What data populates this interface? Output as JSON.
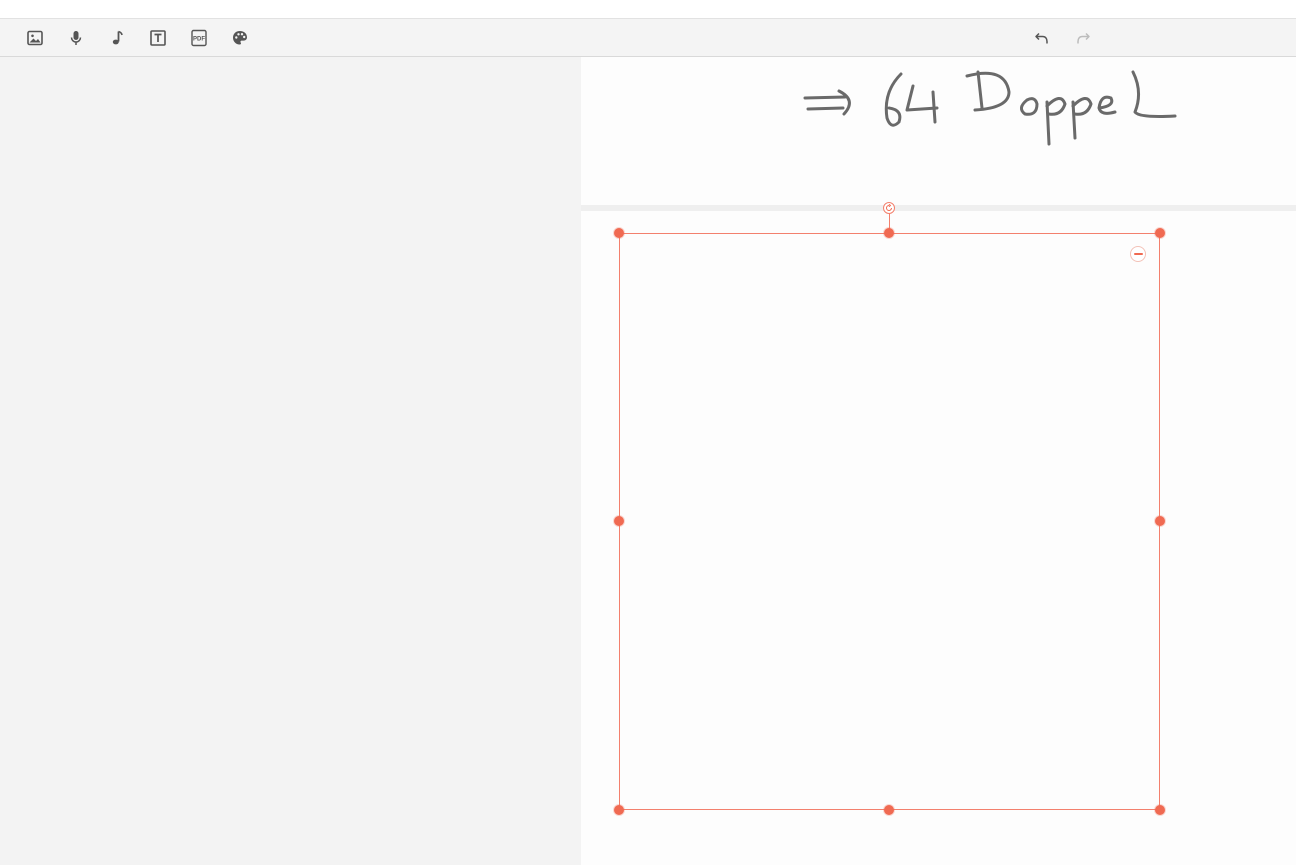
{
  "toolbar": {
    "tools": [
      {
        "name": "insert-image",
        "icon": "image-icon"
      },
      {
        "name": "record-audio",
        "icon": "microphone-icon"
      },
      {
        "name": "insert-music",
        "icon": "music-note-icon"
      },
      {
        "name": "insert-text",
        "icon": "text-box-icon"
      },
      {
        "name": "insert-pdf",
        "icon": "pdf-icon",
        "label": "PDF"
      },
      {
        "name": "color-palette",
        "icon": "palette-icon"
      }
    ],
    "undo": {
      "icon": "undo-icon",
      "enabled": true
    },
    "redo": {
      "icon": "redo-icon",
      "enabled": false
    }
  },
  "canvas": {
    "handwritten_note": "⇒ 64 Doppel"
  },
  "selection": {
    "accent_color": "#f06a52",
    "rotate_icon": "rotate-icon",
    "remove_icon": "minus-icon"
  },
  "colors": {
    "toolbar_bg": "#f4f4f4",
    "sidebar_bg": "#f3f3f3",
    "canvas_bg": "#fdfdfd",
    "icon": "#555555",
    "ink": "#6a6a6a"
  }
}
